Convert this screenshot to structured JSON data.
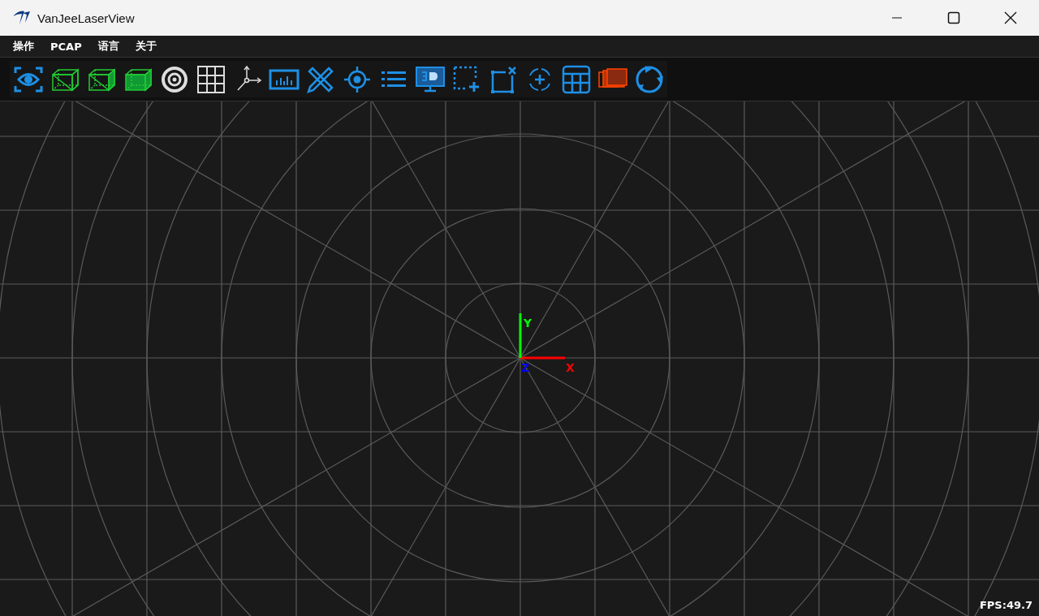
{
  "window": {
    "title": "VanJeeLaserView"
  },
  "menu": [
    {
      "label": "操作"
    },
    {
      "label": "PCAP"
    },
    {
      "label": "语言"
    },
    {
      "label": "关于"
    }
  ],
  "toolbar": [
    {
      "kind": "eye"
    },
    {
      "kind": "cube-empty"
    },
    {
      "kind": "cube-half"
    },
    {
      "kind": "cube-full"
    },
    {
      "kind": "target"
    },
    {
      "kind": "grid"
    },
    {
      "kind": "axes"
    },
    {
      "kind": "chart"
    },
    {
      "kind": "ruler"
    },
    {
      "kind": "crosshair"
    },
    {
      "kind": "list"
    },
    {
      "kind": "monitor"
    },
    {
      "kind": "select-add"
    },
    {
      "kind": "select-remove"
    },
    {
      "kind": "rotate-center"
    },
    {
      "kind": "table"
    },
    {
      "kind": "layers"
    },
    {
      "kind": "refresh"
    }
  ],
  "viewport": {
    "axes": [
      {
        "label": "X",
        "color": "#ff0000"
      },
      {
        "label": "Y",
        "color": "#00ff00"
      },
      {
        "label": "Z",
        "color": "#0000ff"
      }
    ],
    "fps": "FPS:49.7"
  }
}
